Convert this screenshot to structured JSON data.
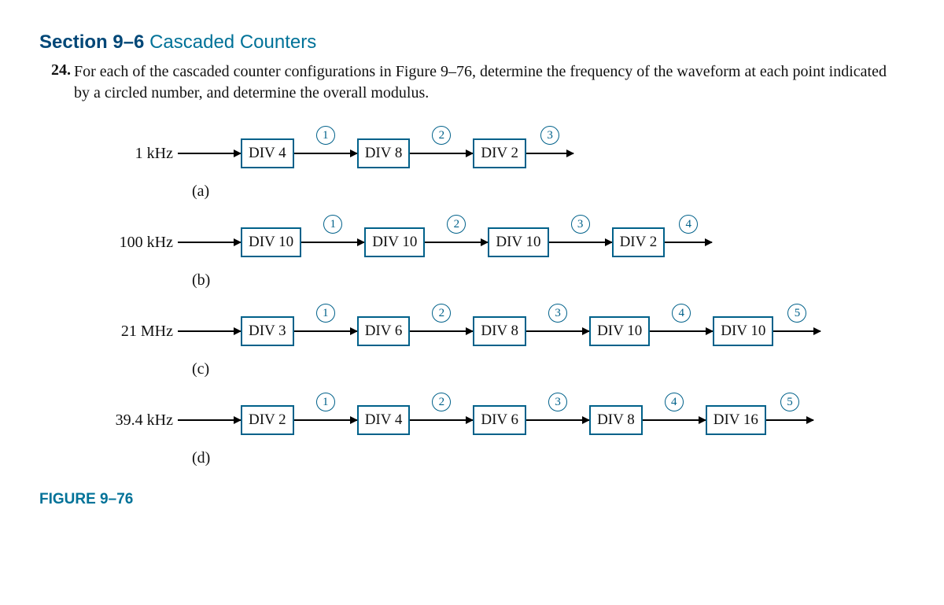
{
  "section": {
    "prefix": "Section 9–6",
    "title": "Cascaded Counters"
  },
  "problem": {
    "number": "24.",
    "text": "For each of the cascaded counter configurations in Figure 9–76, determine the frequency of the waveform at each point indicated by a circled number, and determine the overall modulus."
  },
  "chains": [
    {
      "sublabel": "(a)",
      "input": "1 kHz",
      "blocks": [
        "DIV 4",
        "DIV 8",
        "DIV 2"
      ],
      "nodes": [
        "1",
        "2",
        "3"
      ]
    },
    {
      "sublabel": "(b)",
      "input": "100 kHz",
      "blocks": [
        "DIV 10",
        "DIV 10",
        "DIV 10",
        "DIV 2"
      ],
      "nodes": [
        "1",
        "2",
        "3",
        "4"
      ]
    },
    {
      "sublabel": "(c)",
      "input": "21 MHz",
      "blocks": [
        "DIV 3",
        "DIV 6",
        "DIV 8",
        "DIV 10",
        "DIV 10"
      ],
      "nodes": [
        "1",
        "2",
        "3",
        "4",
        "5"
      ]
    },
    {
      "sublabel": "(d)",
      "input": "39.4 kHz",
      "blocks": [
        "DIV 2",
        "DIV 4",
        "DIV 6",
        "DIV 8",
        "DIV 16"
      ],
      "nodes": [
        "1",
        "2",
        "3",
        "4",
        "5"
      ]
    }
  ],
  "figure_label": "FIGURE 9–76"
}
